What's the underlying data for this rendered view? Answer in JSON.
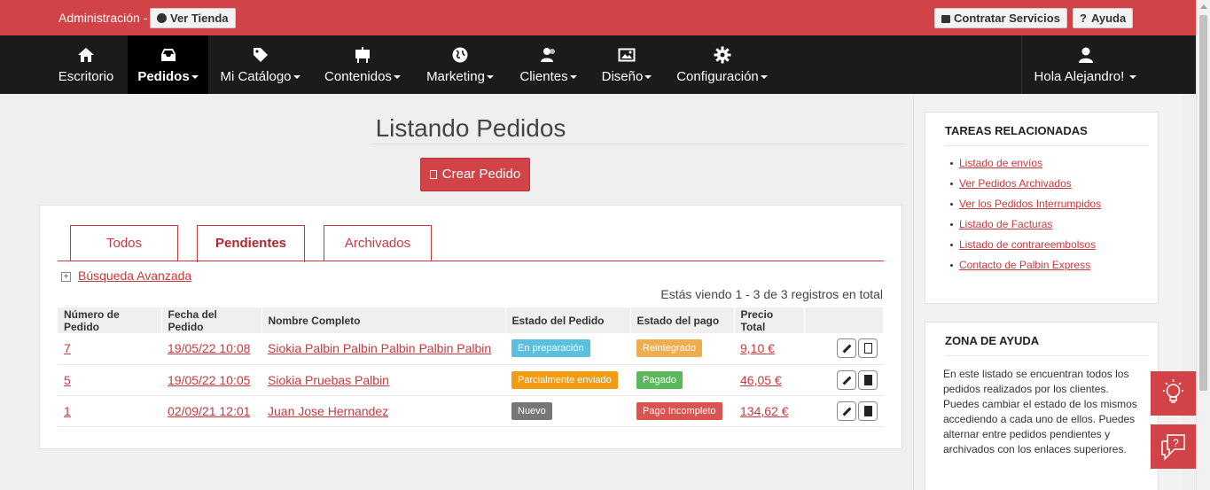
{
  "topbar": {
    "admin_label": "Administración -",
    "view_store": "Ver Tienda",
    "hire_services": "Contratar Servicios",
    "help": "Ayuda",
    "help_icon": "?"
  },
  "nav": {
    "items": [
      {
        "label": "Escritorio",
        "icon": "home-icon",
        "caret": false
      },
      {
        "label": "Pedidos",
        "icon": "inbox-icon",
        "caret": true
      },
      {
        "label": "Mi Catálogo",
        "icon": "tag-icon",
        "caret": true
      },
      {
        "label": "Contenidos",
        "icon": "easel-icon",
        "caret": true
      },
      {
        "label": "Marketing",
        "icon": "globe-icon",
        "caret": true
      },
      {
        "label": "Clientes",
        "icon": "users-icon",
        "caret": true
      },
      {
        "label": "Diseño",
        "icon": "picture-icon",
        "caret": true
      },
      {
        "label": "Configuración",
        "icon": "gear-icon",
        "caret": true
      }
    ],
    "user": "Hola Alejandro!"
  },
  "main": {
    "title": "Listando Pedidos",
    "create_button": "Crear Pedido",
    "tabs": [
      {
        "label": "Todos"
      },
      {
        "label": "Pendientes",
        "active": true
      },
      {
        "label": "Archivados"
      }
    ],
    "advanced_search": "Búsqueda Avanzada",
    "advanced_search_icon": "+",
    "records_text": "Estás viendo 1 - 3 de 3 registros en total",
    "table": {
      "headers": [
        "Número de Pedido",
        "Fecha del Pedido",
        "Nombre Completo",
        "Estado del Pedido",
        "Estado del pago",
        "Precio Total",
        ""
      ],
      "rows": [
        {
          "number": "7",
          "date": "19/05/22 10:08",
          "name": "Siokia Palbin Palbin Palbin Palbin Palbin",
          "order_status": "En preparación",
          "order_status_color": "#5bc0de",
          "payment_status": "Reintegrado",
          "payment_status_color": "#f0ad4e",
          "total": "9,10 €"
        },
        {
          "number": "5",
          "date": "19/05/22 10:05",
          "name": "Siokia Pruebas Palbin",
          "order_status": "Parcialmente enviado",
          "order_status_color": "#f39c12",
          "payment_status": "Pagado",
          "payment_status_color": "#5cb85c",
          "total": "46,05 €"
        },
        {
          "number": "1",
          "date": "02/09/21 12:01",
          "name": "Juan Jose Hernandez",
          "order_status": "Nuevo",
          "order_status_color": "#777777",
          "payment_status": "Pago Incompleto",
          "payment_status_color": "#d9534f",
          "total": "134,62 €"
        }
      ]
    }
  },
  "sidebar": {
    "tasks_title": "TAREAS RELACIONADAS",
    "tasks": [
      "Listado de envíos",
      "Ver Pedidos Archivados",
      "Ver los Pedidos Interrumpidos",
      "Listado de Facturas",
      "Listado de contrareembolsos",
      "Contacto de Palbin Express"
    ],
    "help_title": "ZONA DE AYUDA",
    "help_text": "En este listado se encuentran todos los pedidos realizados por los clientes. Puedes cambiar el estado de los mismos accediendo a cada uno de ellos. Puedes alternar entre pedidos pendientes y archivados con los enlaces superiores."
  },
  "floating": {
    "idea_icon": "lightbulb-icon",
    "support_icon": "question-chat-icon",
    "support_glyph": "?"
  },
  "colors": {
    "brand_red": "#d14346",
    "nav_bg": "#1b1b1b",
    "link_red": "#c9393e"
  }
}
